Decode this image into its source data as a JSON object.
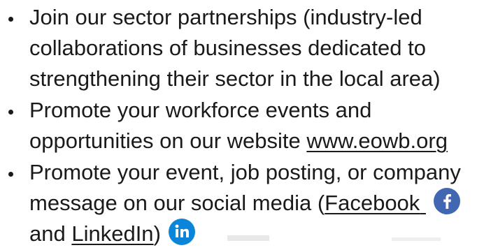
{
  "list": {
    "item1": {
      "line1": "Join our sector partnerships (industry-led",
      "line2": "collaborations of businesses dedicated to",
      "line3": "strengthening their sector in the local area)"
    },
    "item2": {
      "line1": "Promote your workforce events and",
      "line2_prefix": "opportunities on our website ",
      "website_link": "www.eowb.org"
    },
    "item3": {
      "line1": "Promote your event, job posting, or company",
      "line2_prefix": "message on our social media (",
      "facebook_link": "Facebook",
      "line3_prefix": "and ",
      "linkedin_link": "LinkedIn",
      "line3_suffix": ")"
    }
  },
  "icons": {
    "facebook": "facebook-icon",
    "linkedin": "linkedin-icon"
  },
  "colors": {
    "text": "#1a1a1a",
    "facebook": "#4267b2",
    "linkedin": "#0a85d9"
  }
}
